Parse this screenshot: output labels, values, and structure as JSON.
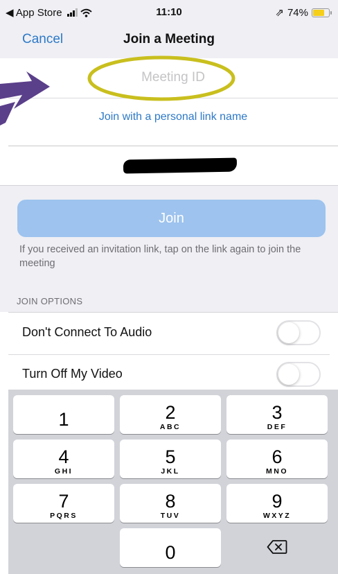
{
  "status_bar": {
    "back_label": "◀ App Store",
    "time": "11:10",
    "location_glyph": "⇗",
    "battery_label": "74%",
    "battery_level": 0.74
  },
  "nav": {
    "cancel_label": "Cancel",
    "title": "Join a Meeting"
  },
  "meeting": {
    "id_placeholder": "Meeting ID",
    "id_value": "",
    "personal_link_label": "Join with a personal link name"
  },
  "name_field": {
    "value_redacted": true
  },
  "join": {
    "button_label": "Join",
    "note": "If you received an invitation link, tap on the link again to join the meeting"
  },
  "options": {
    "header": "JOIN OPTIONS",
    "items": [
      {
        "label": "Don't Connect To Audio",
        "enabled": false
      },
      {
        "label": "Turn Off My Video",
        "enabled": false
      }
    ]
  },
  "keypad": {
    "keys": [
      {
        "digit": "1",
        "letters": ""
      },
      {
        "digit": "2",
        "letters": "ABC"
      },
      {
        "digit": "3",
        "letters": "DEF"
      },
      {
        "digit": "4",
        "letters": "GHI"
      },
      {
        "digit": "5",
        "letters": "JKL"
      },
      {
        "digit": "6",
        "letters": "MNO"
      },
      {
        "digit": "7",
        "letters": "PQRS"
      },
      {
        "digit": "8",
        "letters": "TUV"
      },
      {
        "digit": "9",
        "letters": "WXYZ"
      },
      {
        "digit": "0",
        "letters": ""
      }
    ],
    "delete_icon": "backspace-icon"
  },
  "colors": {
    "accent": "#2d79c7",
    "join_button": "#9dc3ee",
    "annotation_arrow": "#5a3f8a",
    "annotation_ellipse": "#c9bf1e"
  }
}
